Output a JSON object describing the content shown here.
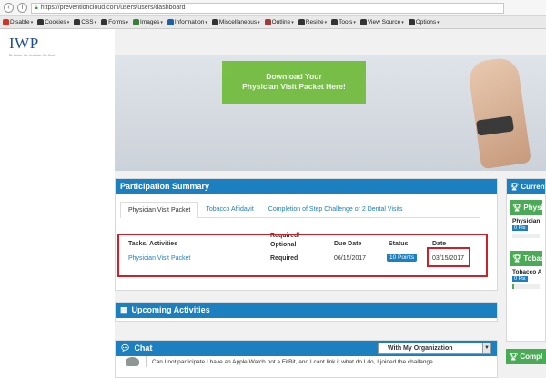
{
  "browser": {
    "url": "https://preventioncloud.com/users/users/dashboard",
    "devbar": [
      {
        "label": "Disable",
        "icon": "no-entry-icon",
        "color": "#d93025"
      },
      {
        "label": "Cookies",
        "icon": "cookie-icon",
        "color": "#333333"
      },
      {
        "label": "CSS",
        "icon": "css-icon",
        "color": "#333333"
      },
      {
        "label": "Forms",
        "icon": "form-icon",
        "color": "#333333"
      },
      {
        "label": "Images",
        "icon": "image-icon",
        "color": "#3a7d3a"
      },
      {
        "label": "Information",
        "icon": "info-icon",
        "color": "#1c5fa8"
      },
      {
        "label": "Miscellaneous",
        "icon": "misc-icon",
        "color": "#333333"
      },
      {
        "label": "Outline",
        "icon": "outline-icon",
        "color": "#a33a3a"
      },
      {
        "label": "Resize",
        "icon": "resize-icon",
        "color": "#333333"
      },
      {
        "label": "Tools",
        "icon": "tools-icon",
        "color": "#333333"
      },
      {
        "label": "View Source",
        "icon": "view-source-icon",
        "color": "#333333"
      },
      {
        "label": "Options",
        "icon": "options-icon",
        "color": "#333333"
      }
    ]
  },
  "logo": {
    "text": "IWP",
    "tagline": "Be Better. Be Healthier. Be Cool."
  },
  "hero": {
    "button_line1": "Download Your",
    "button_line2": "Physician Visit Packet Here!"
  },
  "participation": {
    "title": "Participation Summary",
    "tabs": [
      "Physician Visit Packet",
      "Tobacco Affidavit",
      "Completion of Step Challenge or 2 Dental Visits"
    ],
    "headers": {
      "task": "Tasks/ Activities",
      "required": "Required/ Optional",
      "due": "Due Date",
      "status": "Status",
      "date": "Date"
    },
    "row": {
      "task": "Physician Visit Packet",
      "required": "Required",
      "due": "06/15/2017",
      "status": "10 Points",
      "date": "03/15/2017"
    }
  },
  "upcoming": {
    "title": "Upcoming Activities"
  },
  "chat": {
    "title": "Chat",
    "filter": "With My Organization",
    "message": "Can I not participate I have an Apple Watch not a FitBit, and I cant link it what do I do, I joined the challange"
  },
  "right": {
    "current": "Current",
    "physician_head": "Physic",
    "physician_sub": "Physician",
    "physician_pts": "0 Pts",
    "physician_progress": 0.0,
    "tobacco_head": "Tobac",
    "tobacco_sub": "Tobacco A",
    "tobacco_pts": "0 Pts",
    "tobacco_progress": 0.05,
    "compl_head": "Compl"
  }
}
